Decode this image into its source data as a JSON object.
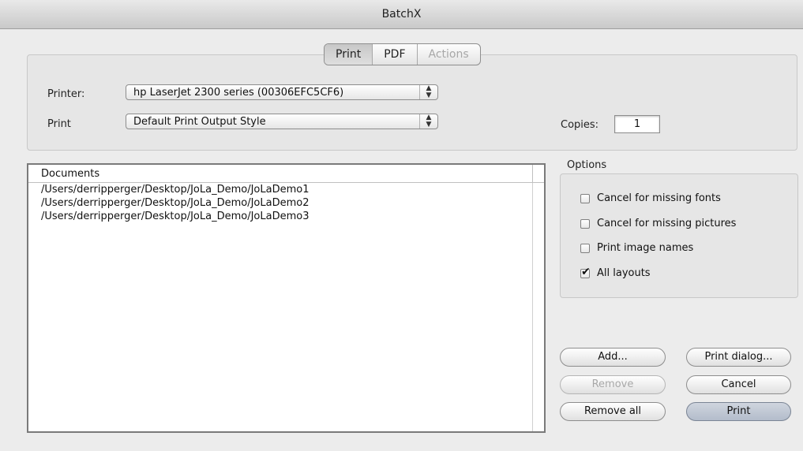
{
  "window": {
    "title": "BatchX"
  },
  "tabs": [
    {
      "label": "Print",
      "state": "active"
    },
    {
      "label": "PDF",
      "state": "normal"
    },
    {
      "label": "Actions",
      "state": "disabled"
    }
  ],
  "printer": {
    "label": "Printer:",
    "value": "hp LaserJet 2300 series (00306EFC5CF6)"
  },
  "print_style": {
    "label": "Print",
    "value": "Default Print Output Style"
  },
  "copies": {
    "label": "Copies:",
    "value": "1"
  },
  "documents": {
    "header": "Documents",
    "rows": [
      "/Users/derripperger/Desktop/JoLa_Demo/JoLaDemo1",
      "/Users/derripperger/Desktop/JoLa_Demo/JoLaDemo2",
      "/Users/derripperger/Desktop/JoLa_Demo/JoLaDemo3"
    ]
  },
  "options": {
    "title": "Options",
    "items": [
      {
        "label": "Cancel for missing fonts",
        "checked": false
      },
      {
        "label": "Cancel for missing pictures",
        "checked": false
      },
      {
        "label": "Print image names",
        "checked": false
      },
      {
        "label": "All layouts",
        "checked": true
      }
    ]
  },
  "buttons": {
    "add": "Add...",
    "remove": "Remove",
    "remove_all": "Remove all",
    "print_dialog": "Print dialog...",
    "cancel": "Cancel",
    "print": "Print"
  }
}
